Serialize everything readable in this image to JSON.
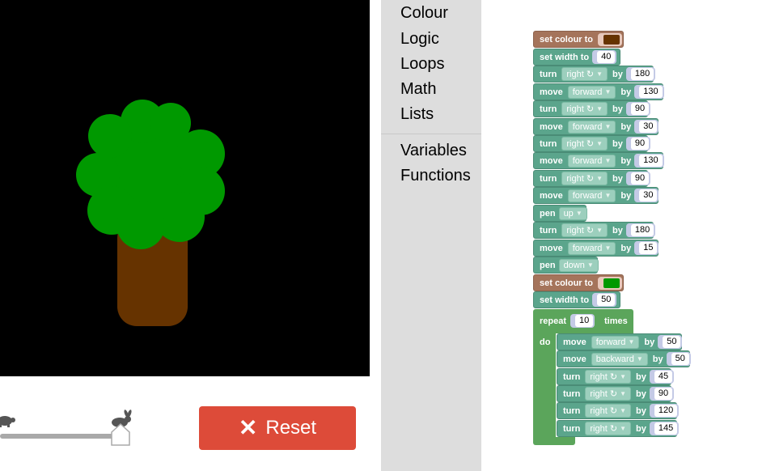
{
  "drawing": {
    "background_color": "#000000",
    "trunk_color": "#663300",
    "canopy_color": "#009900"
  },
  "speed_slider": {
    "value_fraction": 1.0
  },
  "reset_button": {
    "label": "Reset",
    "icon": "close-icon"
  },
  "toolbox": {
    "categories": [
      "Colour",
      "Logic",
      "Loops",
      "Math",
      "Lists"
    ],
    "extra_categories": [
      "Variables",
      "Functions"
    ]
  },
  "blocks": {
    "set_colour_1": {
      "label": "set colour to",
      "color": "#663300"
    },
    "set_width_1": {
      "label": "set width to",
      "value": "40"
    },
    "b3": {
      "kw": "turn",
      "dir": "right ↻",
      "by": "by",
      "value": "180"
    },
    "b4": {
      "kw": "move",
      "dir": "forward",
      "by": "by",
      "value": "130"
    },
    "b5": {
      "kw": "turn",
      "dir": "right ↻",
      "by": "by",
      "value": "90"
    },
    "b6": {
      "kw": "move",
      "dir": "forward",
      "by": "by",
      "value": "30"
    },
    "b7": {
      "kw": "turn",
      "dir": "right ↻",
      "by": "by",
      "value": "90"
    },
    "b8": {
      "kw": "move",
      "dir": "forward",
      "by": "by",
      "value": "130"
    },
    "b9": {
      "kw": "turn",
      "dir": "right ↻",
      "by": "by",
      "value": "90"
    },
    "b10": {
      "kw": "move",
      "dir": "forward",
      "by": "by",
      "value": "30"
    },
    "pen_up": {
      "kw": "pen",
      "value": "up"
    },
    "b12": {
      "kw": "turn",
      "dir": "right ↻",
      "by": "by",
      "value": "180"
    },
    "b13": {
      "kw": "move",
      "dir": "forward",
      "by": "by",
      "value": "15"
    },
    "pen_down": {
      "kw": "pen",
      "value": "down"
    },
    "set_colour_2": {
      "label": "set colour to",
      "color": "#009900"
    },
    "set_width_2": {
      "label": "set width to",
      "value": "50"
    },
    "repeat": {
      "kw": "repeat",
      "value": "10",
      "times": "times",
      "do": "do"
    },
    "r1": {
      "kw": "move",
      "dir": "forward",
      "by": "by",
      "value": "50"
    },
    "r2": {
      "kw": "move",
      "dir": "backward",
      "by": "by",
      "value": "50"
    },
    "r3": {
      "kw": "turn",
      "dir": "right ↻",
      "by": "by",
      "value": "45"
    },
    "r4": {
      "kw": "turn",
      "dir": "right ↻",
      "by": "by",
      "value": "90"
    },
    "r5": {
      "kw": "turn",
      "dir": "right ↻",
      "by": "by",
      "value": "120"
    },
    "r6": {
      "kw": "turn",
      "dir": "right ↻",
      "by": "by",
      "value": "145"
    }
  }
}
